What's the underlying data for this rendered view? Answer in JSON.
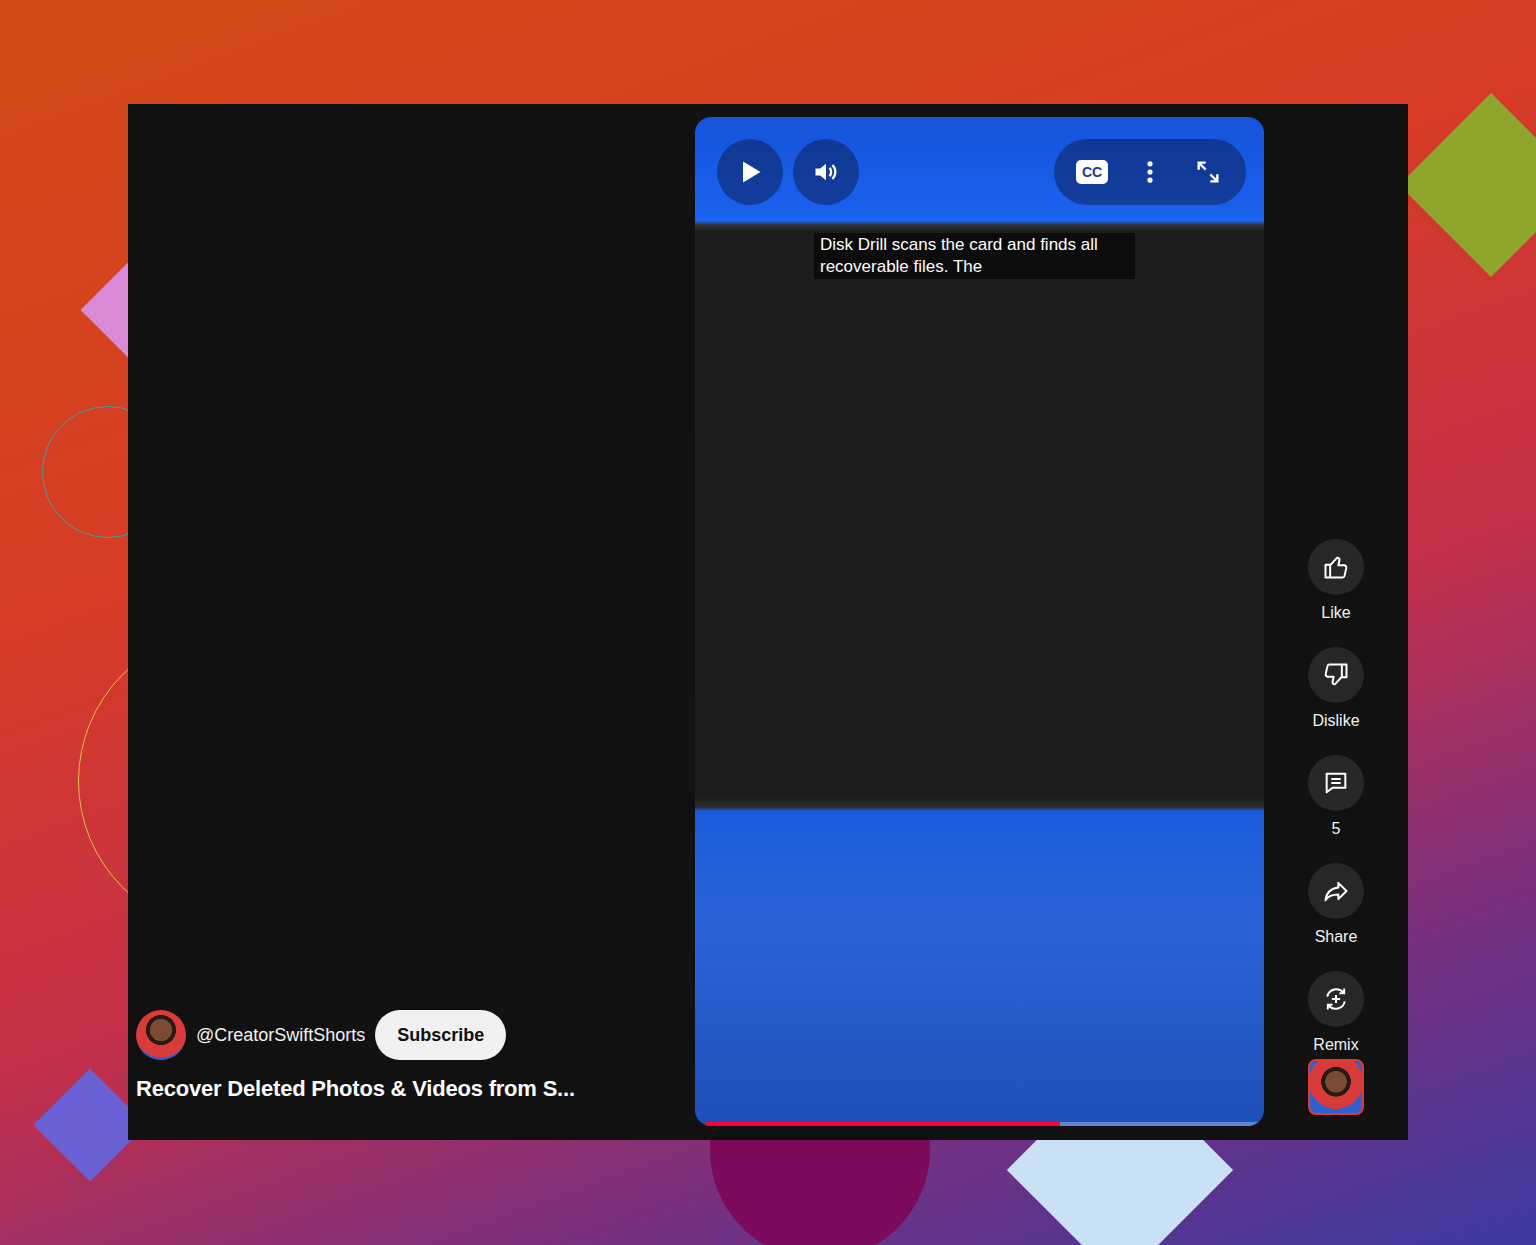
{
  "player": {
    "playing": false,
    "muted": false,
    "captions_on": true,
    "cc_label": "CC",
    "caption": "Disk Drill scans the card and finds all recoverable files. The",
    "progress": {
      "level": 0.64
    }
  },
  "channel": {
    "handle": "@CreatorSwiftShorts",
    "subscribe": "Subscribe"
  },
  "video_title": "Recover Deleted Photos & Videos from S...",
  "actions": [
    {
      "label": "Like",
      "kind": "like"
    },
    {
      "label": "Dislike",
      "kind": "dislike"
    },
    {
      "label": "5",
      "kind": "comments"
    },
    {
      "label": "Share",
      "kind": "share"
    },
    {
      "label": "Remix",
      "kind": "remix"
    }
  ]
}
